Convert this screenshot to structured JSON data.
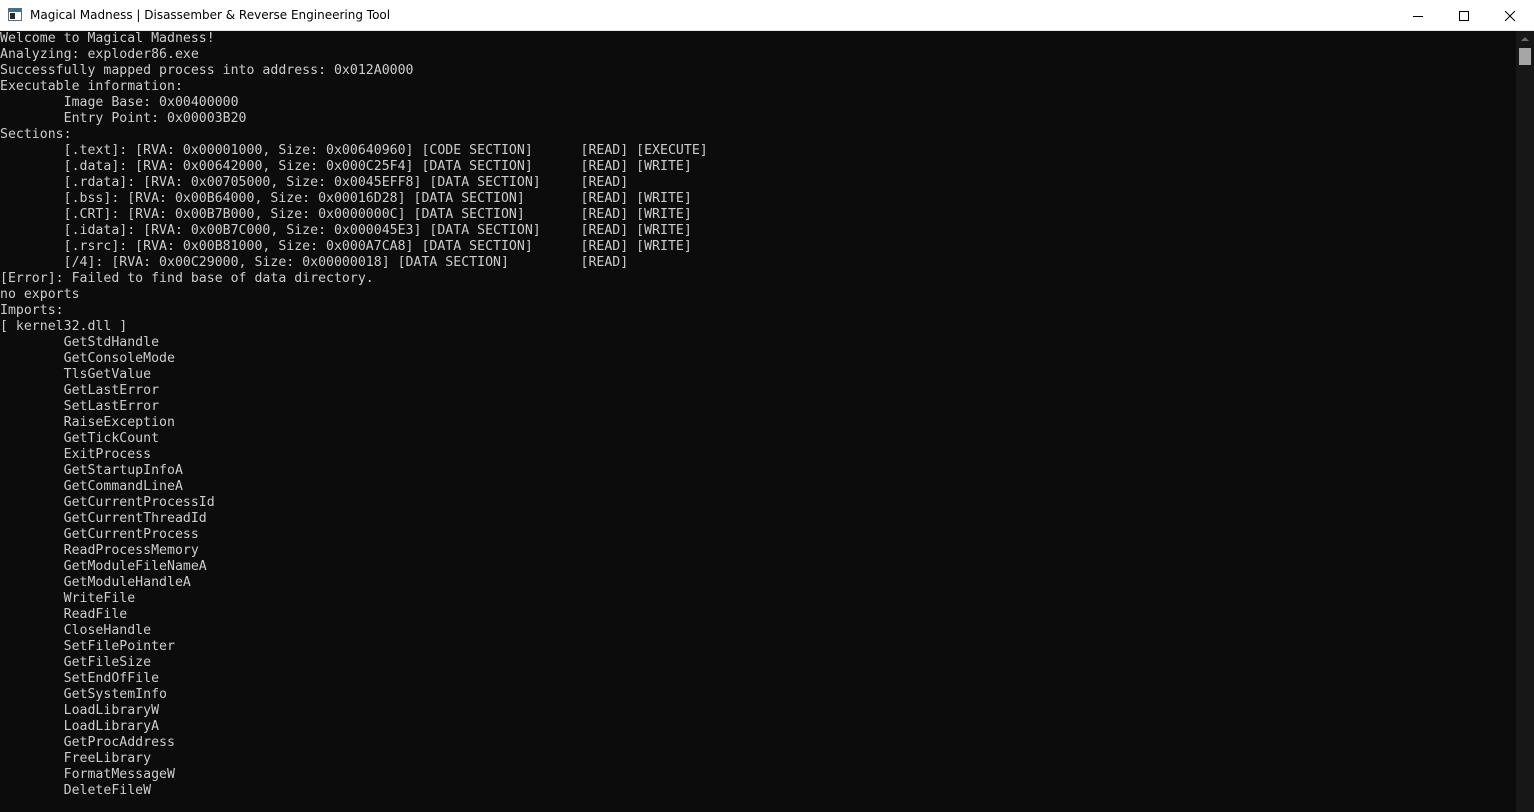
{
  "window": {
    "title": "Magical Madness | Disassember & Reverse Engineering Tool",
    "icon": "console-window-icon",
    "controls": [
      "minimize-icon",
      "maximize-icon",
      "close-icon"
    ]
  },
  "console": {
    "background": "#0c0c0c",
    "foreground": "#cccccc",
    "lines": [
      "Welcome to Magical Madness!",
      "Analyzing: exploder86.exe",
      "Successfully mapped process into address: 0x012A0000",
      "Executable information:",
      "        Image Base: 0x00400000",
      "        Entry Point: 0x00003B20",
      "Sections:",
      "        [.text]: [RVA: 0x00001000, Size: 0x00640960] [CODE SECTION]      [READ] [EXECUTE]",
      "        [.data]: [RVA: 0x00642000, Size: 0x000C25F4] [DATA SECTION]      [READ] [WRITE]",
      "        [.rdata]: [RVA: 0x00705000, Size: 0x0045EFF8] [DATA SECTION]     [READ]",
      "        [.bss]: [RVA: 0x00B64000, Size: 0x00016D28] [DATA SECTION]       [READ] [WRITE]",
      "        [.CRT]: [RVA: 0x00B7B000, Size: 0x0000000C] [DATA SECTION]       [READ] [WRITE]",
      "        [.idata]: [RVA: 0x00B7C000, Size: 0x000045E3] [DATA SECTION]     [READ] [WRITE]",
      "        [.rsrc]: [RVA: 0x00B81000, Size: 0x000A7CA8] [DATA SECTION]      [READ] [WRITE]",
      "        [/4]: [RVA: 0x00C29000, Size: 0x00000018] [DATA SECTION]         [READ]",
      "[Error]: Failed to find base of data directory.",
      "no exports",
      "Imports:",
      "[ kernel32.dll ]",
      "        GetStdHandle",
      "        GetConsoleMode",
      "        TlsGetValue",
      "        GetLastError",
      "        SetLastError",
      "        RaiseException",
      "        GetTickCount",
      "        ExitProcess",
      "        GetStartupInfoA",
      "        GetCommandLineA",
      "        GetCurrentProcessId",
      "        GetCurrentThreadId",
      "        GetCurrentProcess",
      "        ReadProcessMemory",
      "        GetModuleFileNameA",
      "        GetModuleHandleA",
      "        WriteFile",
      "        ReadFile",
      "        CloseHandle",
      "        SetFilePointer",
      "        GetFileSize",
      "        SetEndOfFile",
      "        GetSystemInfo",
      "        LoadLibraryW",
      "        LoadLibraryA",
      "        GetProcAddress",
      "        FreeLibrary",
      "        FormatMessageW",
      "        DeleteFileW"
    ]
  }
}
